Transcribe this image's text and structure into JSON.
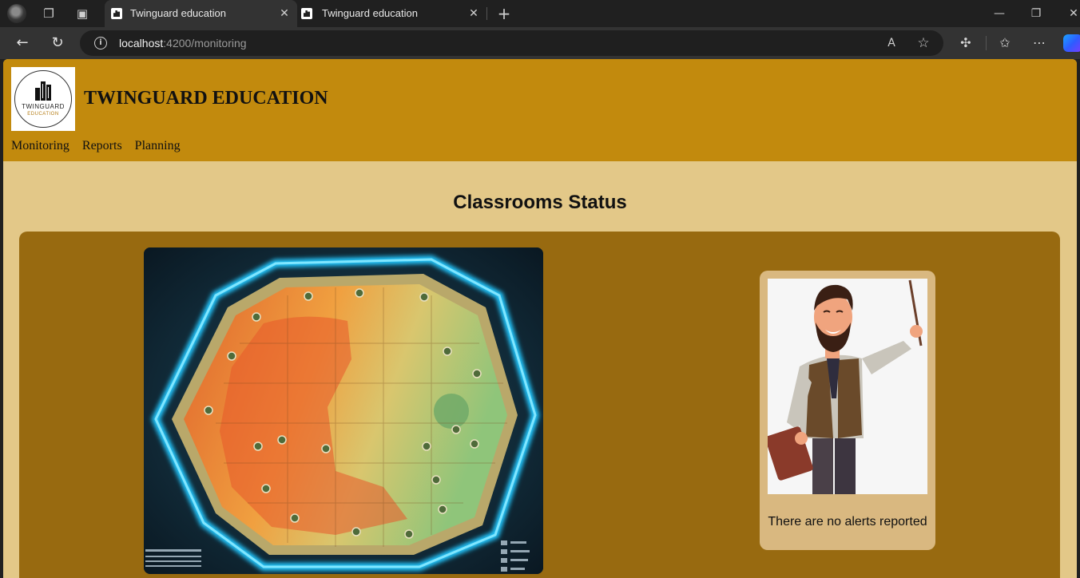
{
  "browser": {
    "tabs": [
      {
        "title": "Twinguard education",
        "active": true
      },
      {
        "title": "Twinguard education",
        "active": false
      }
    ],
    "url_host": "localhost",
    "url_path": ":4200/monitoring",
    "icons": {
      "profile": "profile-avatar-icon",
      "workspaces": "workspaces-icon",
      "tab_actions": "tab-actions-icon",
      "new_tab": "plus-icon",
      "back": "back-arrow-icon",
      "refresh": "refresh-icon",
      "site_info": "info-icon",
      "read_aloud": "read-aloud-icon",
      "favorite": "star-icon",
      "extensions": "puzzle-icon",
      "favorites_list": "favorites-icon",
      "more": "more-icon",
      "copilot": "copilot-icon"
    }
  },
  "app": {
    "title": "TWINGUARD EDUCATION",
    "logo": {
      "line1": "TWINGUARD",
      "line2": "EDUCATION"
    },
    "nav": [
      "Monitoring",
      "Reports",
      "Planning"
    ],
    "colors": {
      "header": "#c28a0d",
      "page": "#e3c888",
      "panel": "#986a10",
      "card": "#d9b880"
    }
  },
  "main": {
    "heading": "Classrooms Status",
    "alert_message": "There are no alerts reported"
  }
}
